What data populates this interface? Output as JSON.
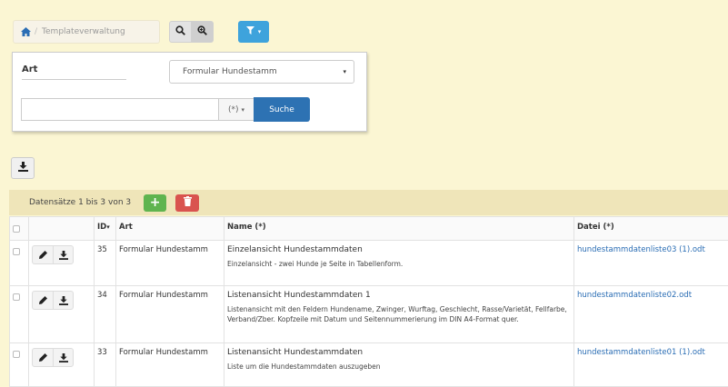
{
  "breadcrumb": {
    "label": "Templateverwaltung"
  },
  "filter": {
    "art_label": "Art",
    "art_value": "Formular Hundestamm",
    "search_value": "",
    "pattern_label": "(*)",
    "search_button": "Suche"
  },
  "records": {
    "summary": "Datensätze 1 bis 3 von 3"
  },
  "table": {
    "headers": {
      "id": "ID",
      "art": "Art",
      "name": "Name (*)",
      "datei": "Datei (*)"
    },
    "rows": [
      {
        "id": "35",
        "art": "Formular Hundestamm",
        "title": "Einzelansicht Hundestammdaten",
        "desc": "Einzelansicht - zwei Hunde je Seite in Tabellenform.",
        "file": "hundestammdatenliste03 (1).odt"
      },
      {
        "id": "34",
        "art": "Formular Hundestamm",
        "title": "Listenansicht Hundestammdaten 1",
        "desc": "Listenansicht mit den Feldern Hundename, Zwinger, Wurftag, Geschlecht, Rasse/Varietät, Fellfarbe, Verband/Zber. Kopfzeile mit Datum und Seitennummerierung im DIN A4-Format quer.",
        "file": "hundestammdatenliste02.odt"
      },
      {
        "id": "33",
        "art": "Formular Hundestamm",
        "title": "Listenansicht Hundestammdaten",
        "desc": "Liste um die Hundestammdaten auszugeben",
        "file": "hundestammdatenliste01 (1).odt"
      }
    ]
  },
  "colors": {
    "background": "#fbf6d3",
    "primary": "#2d72b3",
    "info": "#3ea3dc",
    "success": "#5fb44f",
    "danger": "#d9534f",
    "link": "#2a6db4"
  },
  "icons": [
    "home-icon",
    "search-icon",
    "zoom-in-icon",
    "filter-icon",
    "download-icon",
    "plus-icon",
    "trash-icon",
    "pencil-icon",
    "sort-caret-icon"
  ]
}
